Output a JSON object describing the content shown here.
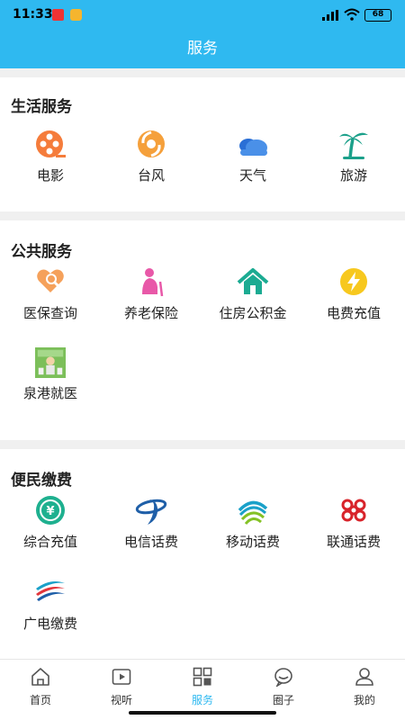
{
  "status": {
    "time": "11:33",
    "battery": "68"
  },
  "header": {
    "title": "服务"
  },
  "sections": [
    {
      "title": "生活服务",
      "items": [
        {
          "label": "电影",
          "icon": "film-reel-icon"
        },
        {
          "label": "台风",
          "icon": "typhoon-icon"
        },
        {
          "label": "天气",
          "icon": "weather-cloud-icon"
        },
        {
          "label": "旅游",
          "icon": "palm-tree-icon"
        }
      ]
    },
    {
      "title": "公共服务",
      "items": [
        {
          "label": "医保查询",
          "icon": "medical-insurance-icon"
        },
        {
          "label": "养老保险",
          "icon": "elderly-icon"
        },
        {
          "label": "住房公积金",
          "icon": "house-icon"
        },
        {
          "label": "电费充值",
          "icon": "lightning-icon"
        },
        {
          "label": "泉港就医",
          "icon": "hospital-image-icon"
        }
      ]
    },
    {
      "title": "便民缴费",
      "items": [
        {
          "label": "综合充值",
          "icon": "yuan-recharge-icon"
        },
        {
          "label": "电信话费",
          "icon": "china-telecom-logo-icon"
        },
        {
          "label": "移动话费",
          "icon": "china-mobile-logo-icon"
        },
        {
          "label": "联通话费",
          "icon": "china-unicom-logo-icon"
        },
        {
          "label": "广电缴费",
          "icon": "broadcast-logo-icon"
        }
      ]
    }
  ],
  "tabs": [
    {
      "label": "首页",
      "icon": "home-icon"
    },
    {
      "label": "视听",
      "icon": "video-play-icon"
    },
    {
      "label": "服务",
      "icon": "grid-icon",
      "active": true
    },
    {
      "label": "圈子",
      "icon": "chat-bubble-icon"
    },
    {
      "label": "我的",
      "icon": "user-icon"
    }
  ],
  "colors": {
    "accent": "#2fb9f0",
    "orange": "#f57c3b",
    "telecom": "#1f5fa8"
  }
}
